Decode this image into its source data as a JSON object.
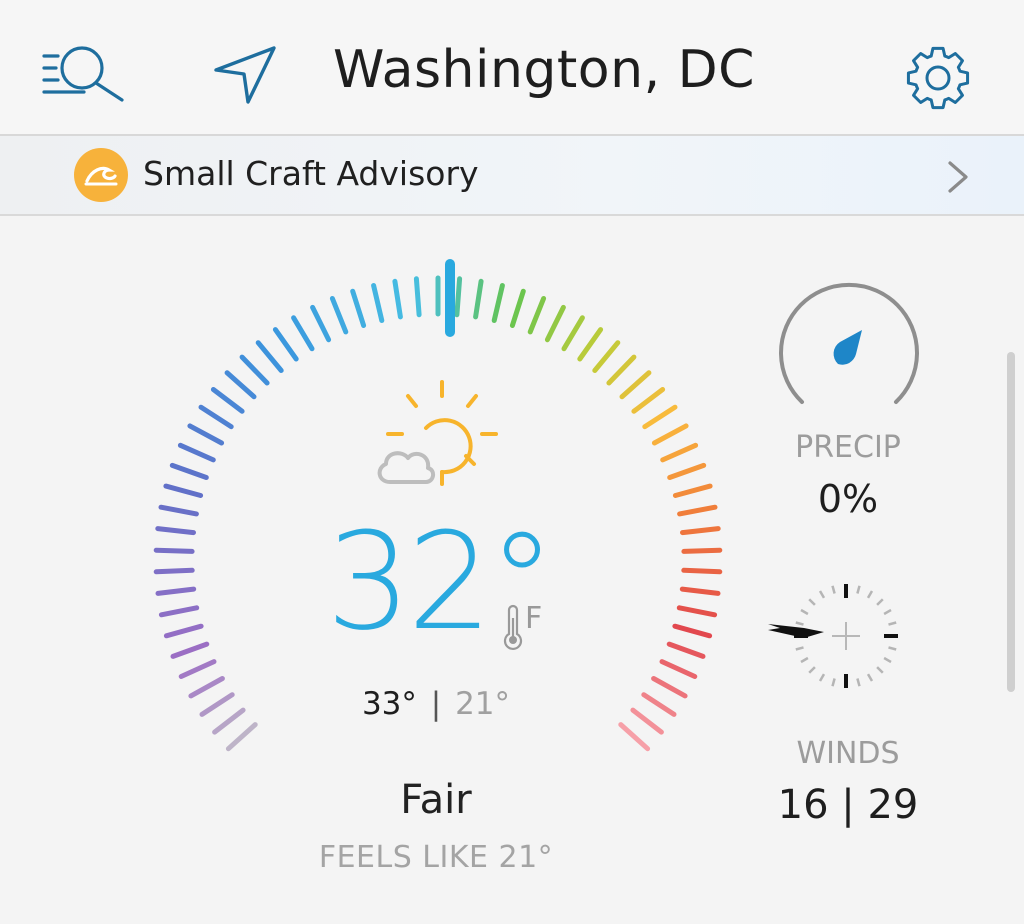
{
  "header": {
    "title": "Washington, DC",
    "accent_color": "#1e6e9e",
    "search_icon": "search-list-icon",
    "locate_icon": "location-arrow-icon",
    "settings_icon": "gear-icon"
  },
  "advisory": {
    "label": "Small Craft Advisory",
    "icon": "wave-icon",
    "icon_color": "#f7b23b",
    "chevron_icon": "chevron-right-icon"
  },
  "current": {
    "temperature": "32",
    "degree_symbol": "°",
    "unit": "F",
    "unit_icon": "thermometer-icon",
    "high": "33°",
    "separator": "|",
    "low": "21°",
    "condition": "Fair",
    "condition_icon": "sun-with-cloud-icon",
    "feels_like": "FEELS LIKE 21°",
    "temp_color": "#29a9df"
  },
  "precip": {
    "label": "PRECIP",
    "value": "0%",
    "icon": "raindrop-icon",
    "dial_color": "#1e86c8"
  },
  "winds": {
    "label": "WINDS",
    "value": "16 | 29",
    "icon": "compass-icon"
  }
}
